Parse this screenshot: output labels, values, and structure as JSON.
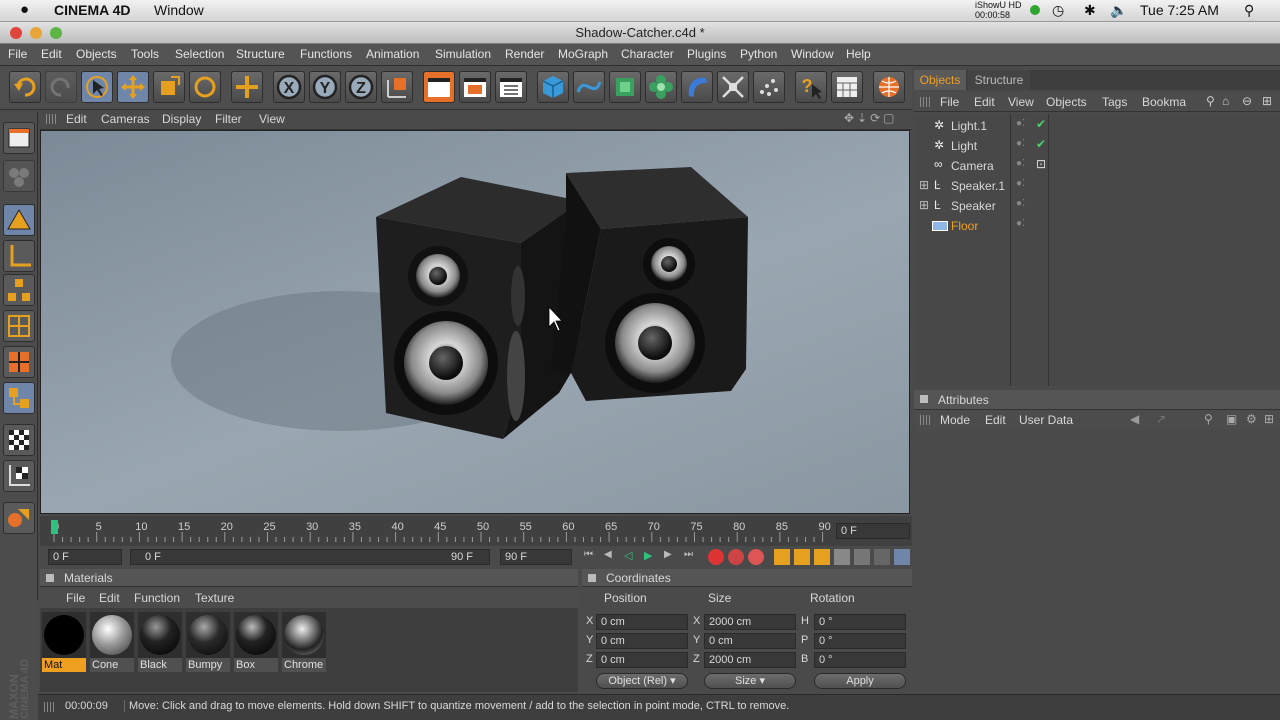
{
  "macbar": {
    "app_name": "CINEMA 4D",
    "window_menu": "Window",
    "recorder": "iShowU HD",
    "recorder_time": "00:00:58",
    "clock": "Tue 7:25 AM"
  },
  "window": {
    "title": "Shadow-Catcher.c4d *"
  },
  "menu": [
    "File",
    "Edit",
    "Objects",
    "Tools",
    "Selection",
    "Structure",
    "Functions",
    "Animation",
    "Simulation",
    "Render",
    "MoGraph",
    "Character",
    "Plugins",
    "Python",
    "Window",
    "Help"
  ],
  "viewport_menu": [
    "Edit",
    "Cameras",
    "Display",
    "Filter",
    "View"
  ],
  "timeline": {
    "ticks": [
      "0",
      "5",
      "10",
      "15",
      "20",
      "25",
      "30",
      "35",
      "40",
      "45",
      "50",
      "55",
      "60",
      "65",
      "70",
      "75",
      "80",
      "85",
      "90"
    ],
    "current_frame": "0 F",
    "start_field": "0 F",
    "range_start": "0 F",
    "range_end": "90 F",
    "end_field": "90 F"
  },
  "materials": {
    "title": "Materials",
    "menu": [
      "File",
      "Edit",
      "Function",
      "Texture"
    ],
    "items": [
      {
        "name": "Mat",
        "selected": true
      },
      {
        "name": "Cone",
        "selected": false
      },
      {
        "name": "Black",
        "selected": false
      },
      {
        "name": "Bumpy",
        "selected": false
      },
      {
        "name": "Box",
        "selected": false
      },
      {
        "name": "Chrome",
        "selected": false
      }
    ]
  },
  "coordinates": {
    "title": "Coordinates",
    "col_position": "Position",
    "col_size": "Size",
    "col_rotation": "Rotation",
    "rows": [
      {
        "pl": "X",
        "pv": "0 cm",
        "sl": "X",
        "sv": "2000 cm",
        "rl": "H",
        "rv": "0 °"
      },
      {
        "pl": "Y",
        "pv": "0 cm",
        "sl": "Y",
        "sv": "0 cm",
        "rl": "P",
        "rv": "0 °"
      },
      {
        "pl": "Z",
        "pv": "0 cm",
        "sl": "Z",
        "sv": "2000 cm",
        "rl": "B",
        "rv": "0 °"
      }
    ],
    "mode_select": "Object (Rel)",
    "size_select": "Size",
    "apply_label": "Apply"
  },
  "objects_panel": {
    "tab_objects": "Objects",
    "tab_structure": "Structure",
    "menu": [
      "File",
      "Edit",
      "View",
      "Objects",
      "Tags",
      "Bookma"
    ],
    "items": [
      {
        "name": "Light.1",
        "icon": "light-icon",
        "expandable": false,
        "highlight": false
      },
      {
        "name": "Light",
        "icon": "light-icon",
        "expandable": false,
        "highlight": false
      },
      {
        "name": "Camera",
        "icon": "camera-icon",
        "expandable": false,
        "highlight": false
      },
      {
        "name": "Speaker.1",
        "icon": "null-icon",
        "expandable": true,
        "highlight": false
      },
      {
        "name": "Speaker",
        "icon": "null-icon",
        "expandable": true,
        "highlight": false
      },
      {
        "name": "Floor",
        "icon": "floor-icon",
        "expandable": false,
        "highlight": true
      }
    ]
  },
  "attributes": {
    "title": "Attributes",
    "menu": [
      "Mode",
      "Edit",
      "User Data"
    ]
  },
  "status": {
    "time": "00:00:09",
    "message": "Move: Click and drag to move elements. Hold down SHIFT to quantize movement / add to the selection in point mode, CTRL to remove."
  },
  "brand": {
    "line1": "MAXON",
    "line2": "CINEMA 4D"
  },
  "colors": {
    "accent": "#f0a020",
    "selected_tool": "#6f86a8",
    "floor_label": "#f0a020"
  }
}
